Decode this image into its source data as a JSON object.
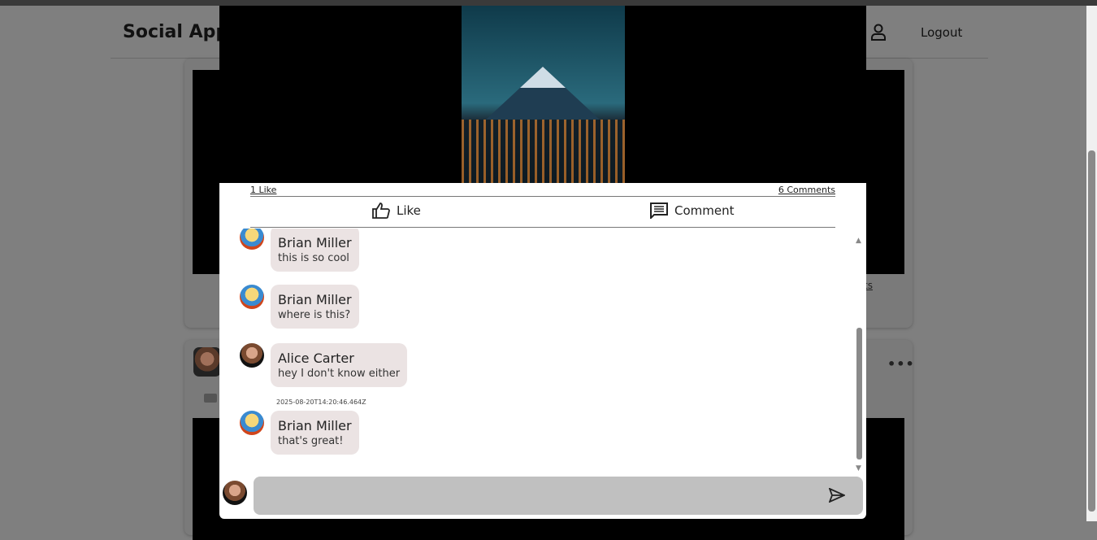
{
  "header": {
    "brand": "Social App",
    "logout": "Logout",
    "user_icon": "user-icon"
  },
  "post": {
    "likes": "1 Like",
    "comments_count": "6 Comments",
    "like_label": "Like",
    "comment_label": "Comment"
  },
  "comments": [
    {
      "author": "Brian Miller",
      "text": "this is so cool"
    },
    {
      "author": "Brian Miller",
      "text": "where is this?"
    },
    {
      "author": "Alice Carter",
      "text": "hey I don't know either",
      "timestamp": "2025-08-20T14:20:46.464Z"
    },
    {
      "author": "Brian Miller",
      "text": "that's great!"
    }
  ],
  "compose": {
    "value": "",
    "placeholder": ""
  },
  "background": {
    "partial_link": "ts"
  }
}
